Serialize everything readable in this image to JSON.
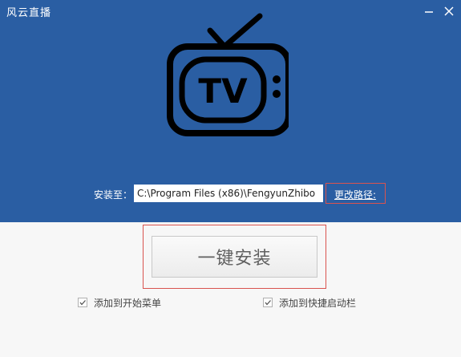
{
  "window": {
    "title": "风云直播",
    "minimize_icon": "minimize-icon",
    "close_icon": "close-icon"
  },
  "logo": {
    "icon": "tv-icon",
    "text": "TV"
  },
  "install": {
    "label": "安装至：",
    "path": "C:\\Program Files (x86)\\FengyunZhibo",
    "change_path_label": "更改路径:",
    "button_label": "一键安装"
  },
  "options": [
    {
      "label": "添加到开始菜单",
      "checked": true
    },
    {
      "label": "添加到快捷启动栏",
      "checked": true
    }
  ],
  "colors": {
    "header_blue": "#2a5ea3",
    "highlight_red": "#d9534f"
  }
}
